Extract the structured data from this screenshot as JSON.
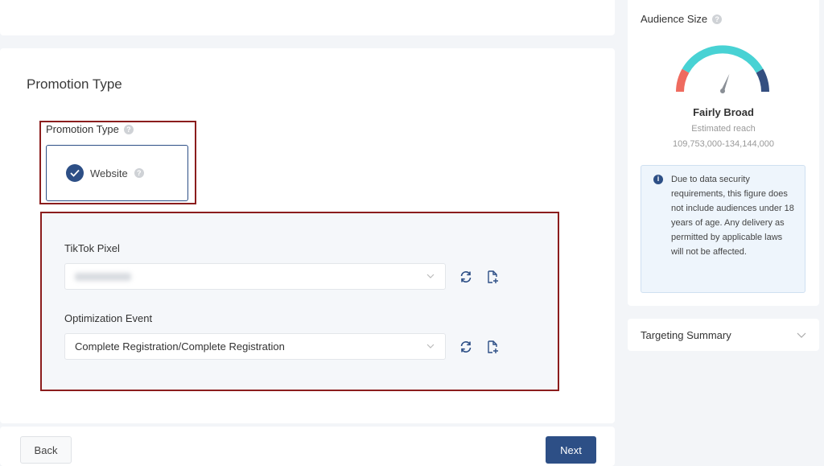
{
  "main": {
    "section_title": "Promotion Type",
    "promotion_type": {
      "label": "Promotion Type",
      "help_icon": "question-circle-icon",
      "selected_option": "Website",
      "option_icon": "check-circle-icon"
    },
    "tiktok_pixel": {
      "label": "TikTok Pixel",
      "value": "(blurred)",
      "refresh_icon": "refresh-icon",
      "create_icon": "file-add-icon"
    },
    "optimization_event": {
      "label": "Optimization Event",
      "value": "Complete Registration/Complete Registration",
      "refresh_icon": "refresh-icon",
      "create_icon": "file-add-icon"
    }
  },
  "footer": {
    "back_label": "Back",
    "next_label": "Next"
  },
  "audience": {
    "title": "Audience Size",
    "level": "Fairly Broad",
    "estimated_label": "Estimated reach",
    "range": "109,753,000-134,144,000",
    "gauge_value": 0.62,
    "colors": {
      "narrow": "#ef6b5f",
      "middle": "#48d2d4",
      "broad": "#344f80"
    },
    "info_text": "Due to data security requirements, this figure does not include audiences under 18 years of age. Any delivery as permitted by applicable laws will not be affected."
  },
  "targeting_summary": {
    "title": "Targeting Summary"
  },
  "colors": {
    "accent": "#2d4f86",
    "highlight_border": "#8b1d1d"
  }
}
